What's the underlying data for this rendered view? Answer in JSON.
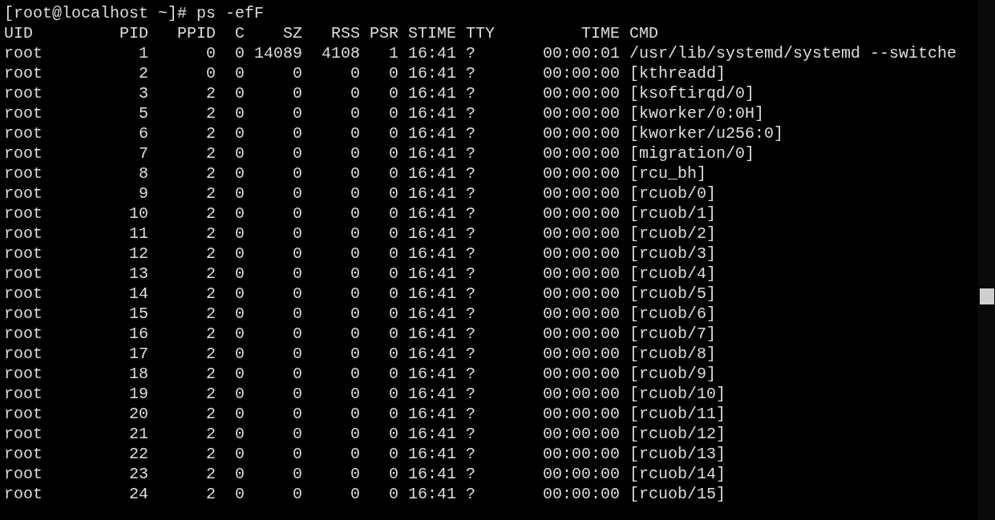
{
  "terminal": {
    "prompt_line": "[root@localhost ~]# ps -efF",
    "columns": [
      "UID",
      "PID",
      "PPID",
      "C",
      "SZ",
      "RSS",
      "PSR",
      "STIME",
      "TTY",
      "TIME",
      "CMD"
    ],
    "rows": [
      [
        "root",
        "1",
        "0",
        "0",
        "14089",
        "4108",
        "1",
        "16:41",
        "?",
        "00:00:01",
        "/usr/lib/systemd/systemd --switche"
      ],
      [
        "root",
        "2",
        "0",
        "0",
        "0",
        "0",
        "0",
        "16:41",
        "?",
        "00:00:00",
        "[kthreadd]"
      ],
      [
        "root",
        "3",
        "2",
        "0",
        "0",
        "0",
        "0",
        "16:41",
        "?",
        "00:00:00",
        "[ksoftirqd/0]"
      ],
      [
        "root",
        "5",
        "2",
        "0",
        "0",
        "0",
        "0",
        "16:41",
        "?",
        "00:00:00",
        "[kworker/0:0H]"
      ],
      [
        "root",
        "6",
        "2",
        "0",
        "0",
        "0",
        "0",
        "16:41",
        "?",
        "00:00:00",
        "[kworker/u256:0]"
      ],
      [
        "root",
        "7",
        "2",
        "0",
        "0",
        "0",
        "0",
        "16:41",
        "?",
        "00:00:00",
        "[migration/0]"
      ],
      [
        "root",
        "8",
        "2",
        "0",
        "0",
        "0",
        "0",
        "16:41",
        "?",
        "00:00:00",
        "[rcu_bh]"
      ],
      [
        "root",
        "9",
        "2",
        "0",
        "0",
        "0",
        "0",
        "16:41",
        "?",
        "00:00:00",
        "[rcuob/0]"
      ],
      [
        "root",
        "10",
        "2",
        "0",
        "0",
        "0",
        "0",
        "16:41",
        "?",
        "00:00:00",
        "[rcuob/1]"
      ],
      [
        "root",
        "11",
        "2",
        "0",
        "0",
        "0",
        "0",
        "16:41",
        "?",
        "00:00:00",
        "[rcuob/2]"
      ],
      [
        "root",
        "12",
        "2",
        "0",
        "0",
        "0",
        "0",
        "16:41",
        "?",
        "00:00:00",
        "[rcuob/3]"
      ],
      [
        "root",
        "13",
        "2",
        "0",
        "0",
        "0",
        "0",
        "16:41",
        "?",
        "00:00:00",
        "[rcuob/4]"
      ],
      [
        "root",
        "14",
        "2",
        "0",
        "0",
        "0",
        "0",
        "16:41",
        "?",
        "00:00:00",
        "[rcuob/5]"
      ],
      [
        "root",
        "15",
        "2",
        "0",
        "0",
        "0",
        "0",
        "16:41",
        "?",
        "00:00:00",
        "[rcuob/6]"
      ],
      [
        "root",
        "16",
        "2",
        "0",
        "0",
        "0",
        "0",
        "16:41",
        "?",
        "00:00:00",
        "[rcuob/7]"
      ],
      [
        "root",
        "17",
        "2",
        "0",
        "0",
        "0",
        "0",
        "16:41",
        "?",
        "00:00:00",
        "[rcuob/8]"
      ],
      [
        "root",
        "18",
        "2",
        "0",
        "0",
        "0",
        "0",
        "16:41",
        "?",
        "00:00:00",
        "[rcuob/9]"
      ],
      [
        "root",
        "19",
        "2",
        "0",
        "0",
        "0",
        "0",
        "16:41",
        "?",
        "00:00:00",
        "[rcuob/10]"
      ],
      [
        "root",
        "20",
        "2",
        "0",
        "0",
        "0",
        "0",
        "16:41",
        "?",
        "00:00:00",
        "[rcuob/11]"
      ],
      [
        "root",
        "21",
        "2",
        "0",
        "0",
        "0",
        "0",
        "16:41",
        "?",
        "00:00:00",
        "[rcuob/12]"
      ],
      [
        "root",
        "22",
        "2",
        "0",
        "0",
        "0",
        "0",
        "16:41",
        "?",
        "00:00:00",
        "[rcuob/13]"
      ],
      [
        "root",
        "23",
        "2",
        "0",
        "0",
        "0",
        "0",
        "16:41",
        "?",
        "00:00:00",
        "[rcuob/14]"
      ],
      [
        "root",
        "24",
        "2",
        "0",
        "0",
        "0",
        "0",
        "16:41",
        "?",
        "00:00:00",
        "[rcuob/15]"
      ]
    ]
  }
}
